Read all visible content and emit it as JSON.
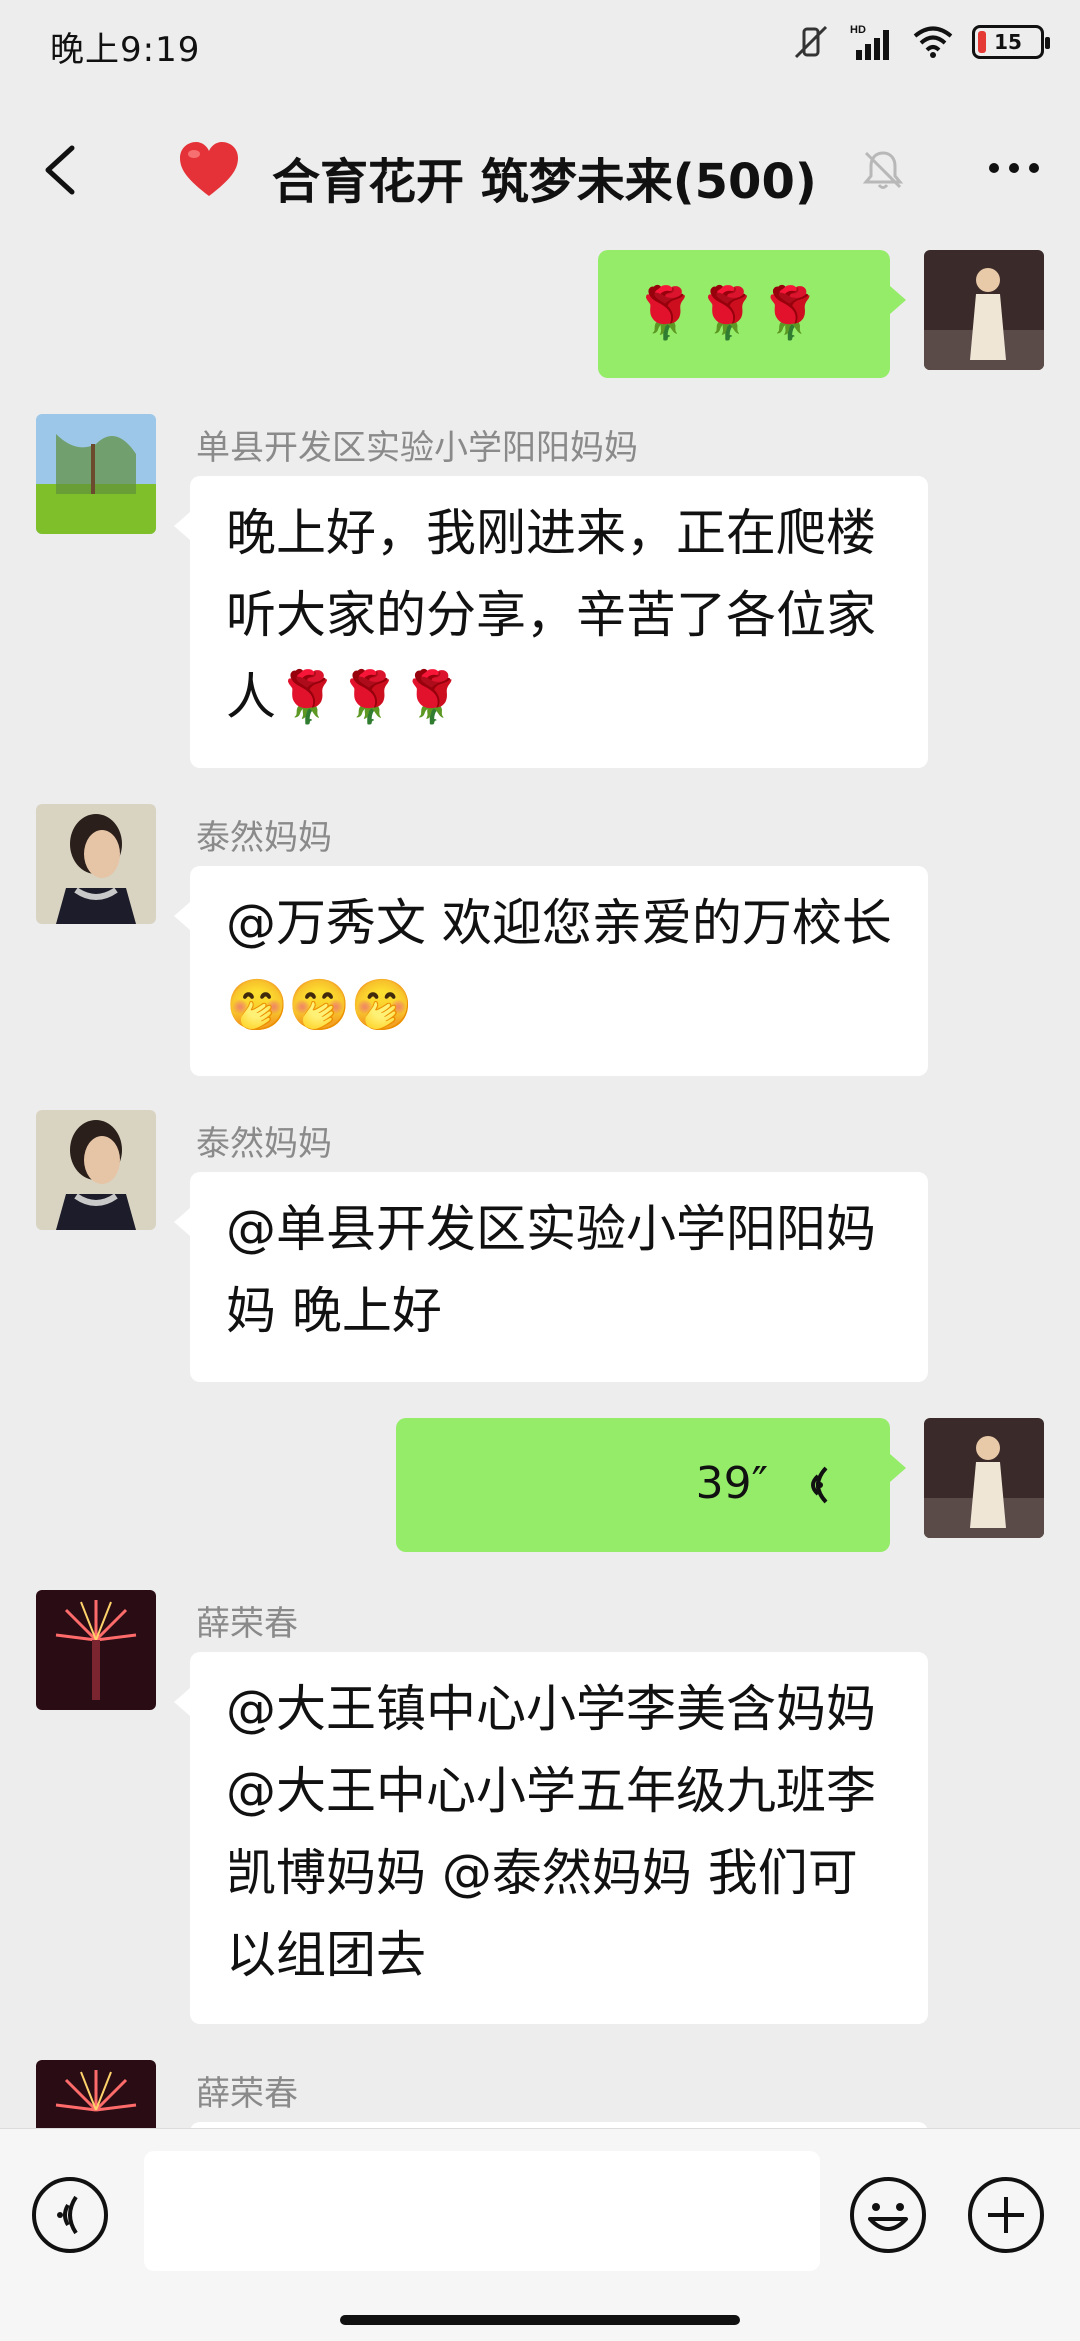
{
  "status_bar": {
    "time": "晚上9:19",
    "network_label": "HD",
    "battery": "15"
  },
  "header": {
    "title": "合育花开 筑梦未来(500)"
  },
  "messages": [
    {
      "side": "right",
      "text": "🌹🌹🌹"
    },
    {
      "side": "left",
      "sender": "单县开发区实验小学阳阳妈妈",
      "text": "晚上好，我刚进来，正在爬楼听大家的分享，辛苦了各位家人🌹🌹🌹"
    },
    {
      "side": "left",
      "sender": "泰然妈妈",
      "text": "@万秀文  欢迎您亲爱的万校长🤭🤭🤭"
    },
    {
      "side": "left",
      "sender": "泰然妈妈",
      "text": "@单县开发区实验小学阳阳妈妈  晚上好"
    },
    {
      "side": "right",
      "type": "voice",
      "duration": "39″"
    },
    {
      "side": "left",
      "sender": "薛荣春",
      "text": "@大王镇中心小学李美含妈妈@大王中心小学五年级九班李凯博妈妈 @泰然妈妈 我们可以组团去"
    },
    {
      "side": "left",
      "sender": "薛荣春",
      "text": ""
    }
  ],
  "input": {
    "value": "",
    "placeholder": ""
  },
  "colors": {
    "bubble_self": "#95ec69",
    "bubble_other": "#ffffff",
    "background": "#ededed"
  }
}
